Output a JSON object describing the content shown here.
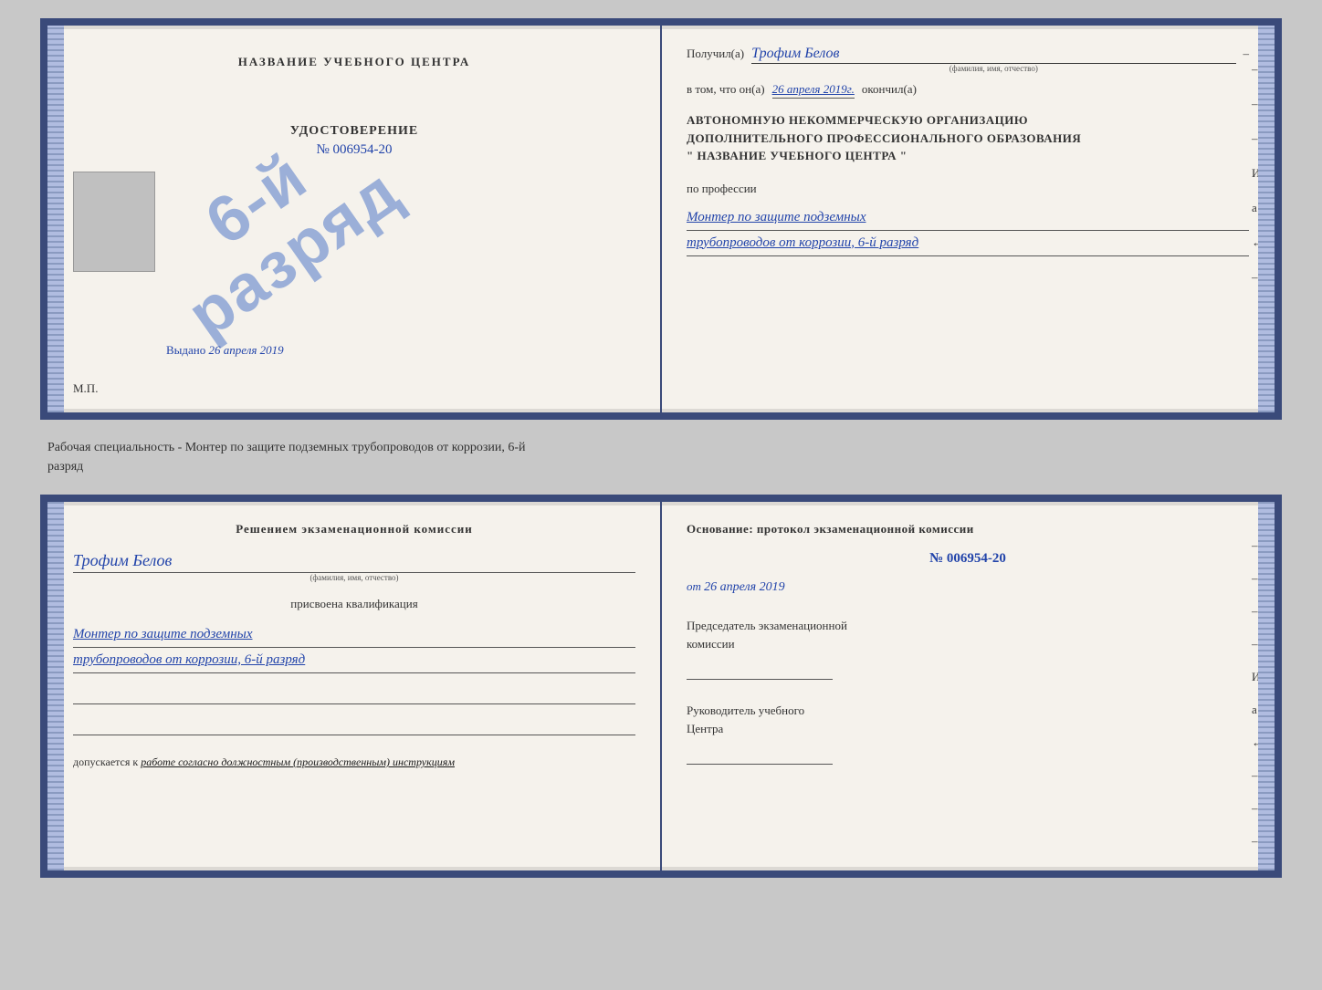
{
  "top_doc": {
    "left": {
      "title": "НАЗВАНИЕ УЧЕБНОГО ЦЕНТРА",
      "stamp_line1": "6-й",
      "stamp_line2": "разряд",
      "udostoverenie_label": "УДОСТОВЕРЕНИЕ",
      "udostoverenie_num_prefix": "№ ",
      "udostoverenie_num": "006954-20",
      "vydano_label": "Выдано",
      "vydano_date": "26 апреля 2019",
      "mp_label": "М.П."
    },
    "right": {
      "poluchil_label": "Получил(а)",
      "poluchil_name": "Трофим Белов",
      "fio_hint": "(фамилия, имя, отчество)",
      "dash": "–",
      "vtom_label": "в том, что он(а)",
      "vtom_date": "26 апреля 2019г.",
      "okonchill_label": "окончил(а)",
      "org_line1": "АВТОНОМНУЮ НЕКОММЕРЧЕСКУЮ ОРГАНИЗАЦИЮ",
      "org_line2": "ДОПОЛНИТЕЛЬНОГО ПРОФЕССИОНАЛЬНОГО ОБРАЗОВАНИЯ",
      "org_line3": "\"    НАЗВАНИЕ УЧЕБНОГО ЦЕНТРА    \"",
      "po_professii": "по профессии",
      "profession_line1": "Монтер по защите подземных",
      "profession_line2": "трубопроводов от коррозии, 6-й разряд",
      "dashes": [
        "–",
        "–",
        "–",
        "И",
        "а",
        "←",
        "–"
      ]
    }
  },
  "middle_text": {
    "line1": "Рабочая специальность - Монтер по защите подземных трубопроводов от коррозии, 6-й",
    "line2": "разряд"
  },
  "bottom_doc": {
    "left": {
      "resheniem_title": "Решением  экзаменационной  комиссии",
      "name": "Трофим Белов",
      "fio_hint": "(фамилия, имя, отчество)",
      "prisvoyena": "присвоена квалификация",
      "qualification_line1": "Монтер по защите подземных",
      "qualification_line2": "трубопроводов от коррозии, 6-й разряд",
      "допускается_label": "допускается к",
      "допускается_value": "работе согласно должностным (производственным) инструкциям"
    },
    "right": {
      "osnovanie_title": "Основание:  протокол  экзаменационной  комиссии",
      "protocol_num": "№  006954-20",
      "ot_prefix": "от",
      "ot_date": "26 апреля 2019",
      "predsedatel_title": "Председатель экзаменационной\nкомиссии",
      "rukovoditel_title": "Руководитель учебного\nЦентра",
      "dashes": [
        "–",
        "–",
        "–",
        "–",
        "И",
        "а",
        "←",
        "–",
        "–",
        "–",
        "–"
      ]
    }
  }
}
